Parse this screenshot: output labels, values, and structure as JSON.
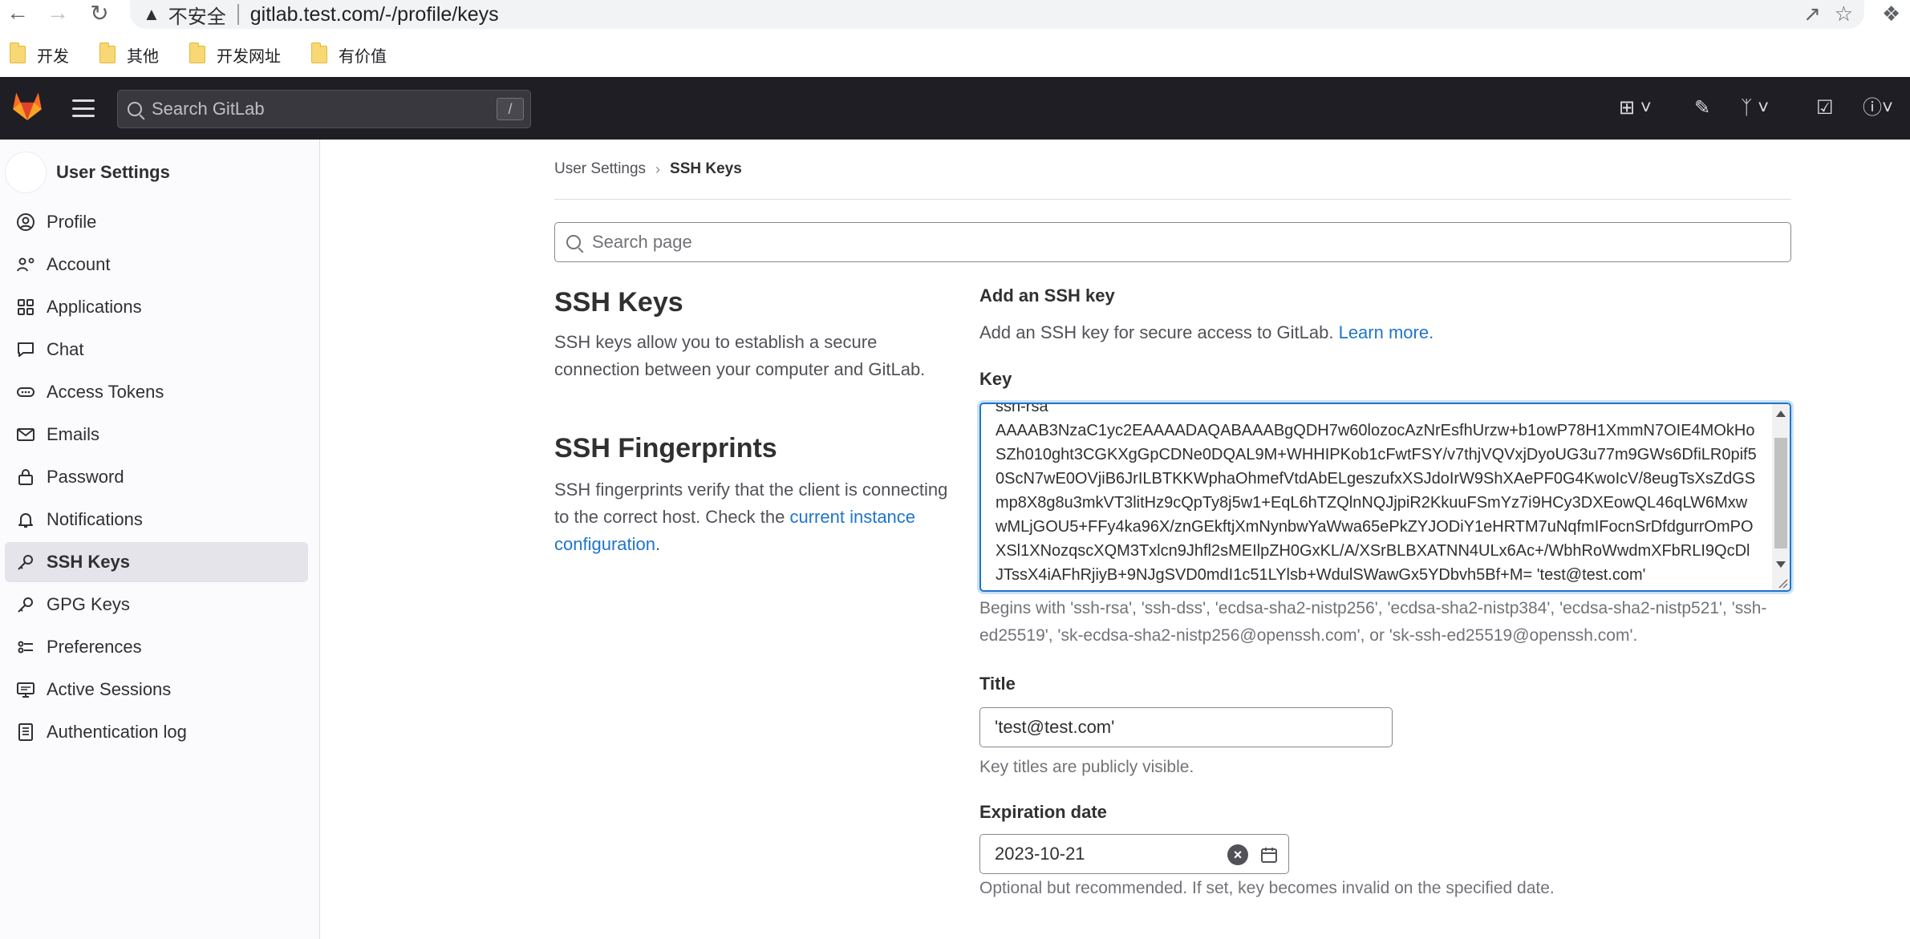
{
  "browser": {
    "security_label": "不安全",
    "url": "gitlab.test.com/-/profile/keys",
    "bookmarks": [
      "开发",
      "其他",
      "开发网址",
      "有价值"
    ]
  },
  "gitlab_header": {
    "search_placeholder": "Search GitLab",
    "search_shortcut": "/"
  },
  "sidebar": {
    "title": "User Settings",
    "items": [
      {
        "label": "Profile",
        "icon": "profile-icon"
      },
      {
        "label": "Account",
        "icon": "account-icon"
      },
      {
        "label": "Applications",
        "icon": "applications-icon"
      },
      {
        "label": "Chat",
        "icon": "chat-icon"
      },
      {
        "label": "Access Tokens",
        "icon": "token-icon"
      },
      {
        "label": "Emails",
        "icon": "mail-icon"
      },
      {
        "label": "Password",
        "icon": "lock-icon"
      },
      {
        "label": "Notifications",
        "icon": "bell-icon"
      },
      {
        "label": "SSH Keys",
        "icon": "key-icon",
        "active": true
      },
      {
        "label": "GPG Keys",
        "icon": "key-icon"
      },
      {
        "label": "Preferences",
        "icon": "preferences-icon"
      },
      {
        "label": "Active Sessions",
        "icon": "monitor-icon"
      },
      {
        "label": "Authentication log",
        "icon": "log-icon"
      }
    ]
  },
  "breadcrumb": {
    "parent": "User Settings",
    "current": "SSH Keys"
  },
  "page_search": {
    "placeholder": "Search page"
  },
  "ssh_keys_section": {
    "title": "SSH Keys",
    "description": "SSH keys allow you to establish a secure connection between your computer and GitLab."
  },
  "fingerprints_section": {
    "title": "SSH Fingerprints",
    "description": "SSH fingerprints verify that the client is connecting to the correct host. Check the",
    "link": "current instance configuration",
    "suffix": "."
  },
  "form": {
    "heading": "Add an SSH key",
    "intro": "Add an SSH key for secure access to GitLab.",
    "learn_more": "Learn more.",
    "key_label": "Key",
    "key_value": "ssh-rsa\nAAAAB3NzaC1yc2EAAAADAQABAAABgQDH7w60lozocAzNrEsfhUrzw+b1owP78H1XmmN7OIE4MOkHoSZh010ght3CGKXgGpCDNe0DQAL9M+WHHIPKob1cFwtFSY/v7thjVQVxjDyoUG3u77m9GWs6DfiLR0pif50ScN7wE0OVjiB6JrILBTKKWphaOhmefVtdAbELgeszufxXSJdoIrW9ShXAePF0G4KwoIcV/8eugTsXsZdGSmp8X8g8u3mkVT3litHz9cQpTy8j5w1+EqL6hTZQlnNQJjpiR2KkuuFSmYz7i9HCy3DXEowQL46qLW6MxwwMLjGOU5+FFy4ka96X/znGEkftjXmNynbwYaWwa65ePkZYJODiY1eHRTM7uNqfmIFocnSrDfdgurrOmPOXSl1XNozqscXQM3Txlcn9Jhfl2sMEIlpZH0GxKL/A/XSrBLBXATNN4ULx6Ac+/WbhRoWwdmXFbRLI9QcDlJTssX4iAFhRjiyB+9NJgSVD0mdI1c51LYlsb+WdulSWawGx5YDbvh5Bf+M= 'test@test.com'",
    "key_help": "Begins with 'ssh-rsa', 'ssh-dss', 'ecdsa-sha2-nistp256', 'ecdsa-sha2-nistp384', 'ecdsa-sha2-nistp521', 'ssh-ed25519', 'sk-ecdsa-sha2-nistp256@openssh.com', or 'sk-ssh-ed25519@openssh.com'.",
    "title_label": "Title",
    "title_value": "'test@test.com'",
    "title_help": "Key titles are publicly visible.",
    "expiration_label": "Expiration date",
    "expiration_value": "2023-10-21",
    "expiration_help": "Optional but recommended. If set, key becomes invalid on the specified date."
  },
  "colors": {
    "header_bg": "#1f1e24",
    "sidebar_bg": "#fbfafd",
    "link": "#1f75cb",
    "focus": "#1f75cb"
  }
}
